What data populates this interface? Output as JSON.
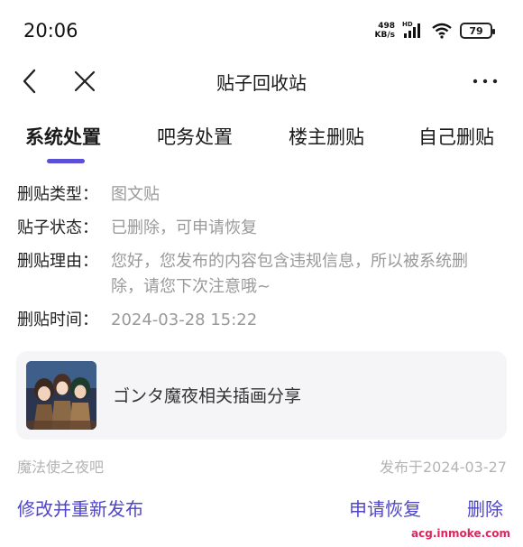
{
  "status_bar": {
    "time": "20:06",
    "net_speed_value": "498",
    "net_speed_unit": "KB/s",
    "hd_label": "HD",
    "battery": "79"
  },
  "nav": {
    "title": "贴子回收站",
    "icons": {
      "back": "chevron-left-icon",
      "close": "close-icon",
      "more": "more-icon"
    }
  },
  "tabs": [
    {
      "label": "系统处置",
      "active": true
    },
    {
      "label": "吧务处置",
      "active": false
    },
    {
      "label": "楼主删贴",
      "active": false
    },
    {
      "label": "自己删贴",
      "active": false
    }
  ],
  "info": {
    "type_label": "删贴类型：",
    "type_value": "图文贴",
    "status_label": "贴子状态：",
    "status_value": "已删除，可申请恢复",
    "reason_label": "删贴理由：",
    "reason_value": "您好，您发布的内容包含违规信息，所以被系统删除，请您下次注意哦~",
    "time_label": "删贴时间：",
    "time_value": "2024-03-28 15:22"
  },
  "post": {
    "title": "ゴンタ魔夜相关插画分享"
  },
  "meta": {
    "forum": "魔法使之夜吧",
    "published": "发布于2024-03-27"
  },
  "actions": {
    "edit": "修改并重新发布",
    "restore": "申请恢复",
    "delete": "删除"
  },
  "watermark": "acg.inmoke.com",
  "colors": {
    "accent": "#5b4fd6",
    "action": "#4f45c9",
    "muted": "#999999",
    "card_bg": "#f5f5f7"
  }
}
